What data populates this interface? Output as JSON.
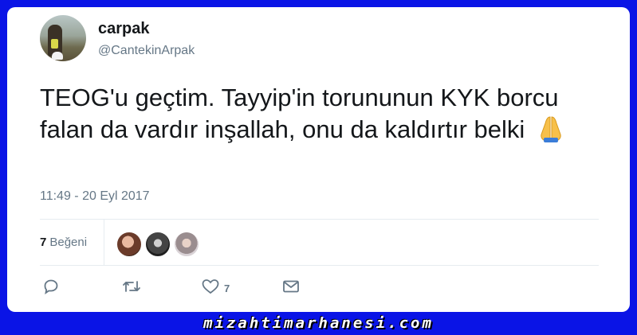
{
  "user": {
    "display_name": "carpak",
    "handle": "@CantekinArpak"
  },
  "tweet": {
    "text": "TEOG'u geçtim. Tayyip'in torununun KYK borcu falan da vardır inşallah, onu da kaldırtır belki",
    "emoji_icon": "folded-hands-icon",
    "timestamp": "11:49 - 20 Eyl 2017"
  },
  "stats": {
    "likes_count": "7",
    "likes_label": "Beğeni"
  },
  "actions": {
    "reply_icon": "reply-icon",
    "retweet_icon": "retweet-icon",
    "like_icon": "heart-icon",
    "like_count": "7",
    "message_icon": "envelope-icon"
  },
  "footer": {
    "watermark": "mizahtimarhanesi.com"
  },
  "colors": {
    "background": "#0a14e6",
    "card": "#ffffff",
    "text": "#14171a",
    "secondary": "#657786",
    "divider": "#e6ecf0"
  }
}
